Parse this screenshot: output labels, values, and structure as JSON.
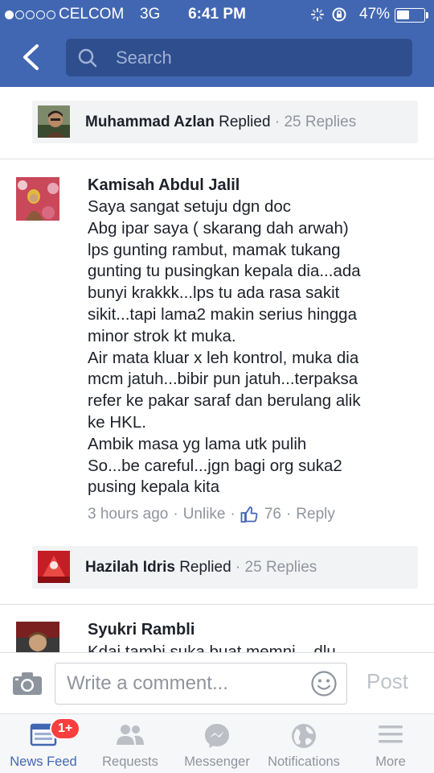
{
  "status_bar": {
    "carrier": "CELCOM",
    "network": "3G",
    "time": "6:41 PM",
    "battery": "47%",
    "battery_level": 0.47,
    "signal_bars_filled": 1,
    "signal_bars_total": 5
  },
  "header": {
    "search_placeholder": "Search"
  },
  "thread": {
    "reply_summary_1": {
      "name": "Muhammad Azlan",
      "verb": "Replied",
      "separator": "·",
      "replies": "25 Replies"
    },
    "comment": {
      "author": "Kamisah Abdul Jalil",
      "lines": [
        "Saya sangat setuju dgn doc",
        "Abg ipar saya ( skarang dah arwah)",
        "lps gunting rambut, mamak tukang",
        "gunting tu pusingkan kepala dia...ada",
        "bunyi krakkk...lps tu ada rasa sakit",
        "sikit...tapi lama2 makin serius hingga",
        "minor strok kt muka.",
        "Air mata kluar x leh kontrol, muka dia",
        "mcm jatuh...bibir pun jatuh...terpaksa",
        "refer ke pakar saraf dan berulang alik",
        "ke HKL.",
        "Ambik masa yg lama utk pulih",
        "So...be careful...jgn bagi org suka2",
        "pusing kepala kita"
      ],
      "time": "3 hours ago",
      "separator": "·",
      "unlike_label": "Unlike",
      "like_count": "76",
      "reply_label": "Reply"
    },
    "reply_summary_2": {
      "name": "Hazilah Idris",
      "verb": "Replied",
      "separator": "·",
      "replies": "25 Replies"
    },
    "next_comment": {
      "author": "Syukri Rambli",
      "partial_text": "Kdai tambi suka buat memni... dlu"
    }
  },
  "composer": {
    "placeholder": "Write a comment...",
    "post_label": "Post"
  },
  "tab_bar": {
    "tabs": [
      {
        "label": "News Feed",
        "icon": "news-feed-icon",
        "badge": "1+"
      },
      {
        "label": "Requests",
        "icon": "friend-requests-icon"
      },
      {
        "label": "Messenger",
        "icon": "messenger-icon"
      },
      {
        "label": "Notifications",
        "icon": "globe-icon"
      },
      {
        "label": "More",
        "icon": "menu-icon"
      }
    ]
  },
  "colors": {
    "header": "#4267b2",
    "search_field": "#2f4e8e",
    "reply_bar": "#f2f3f5",
    "active_tab": "#4267b2",
    "badge": "#fa3e3e",
    "like_blue": "#4267b2"
  }
}
